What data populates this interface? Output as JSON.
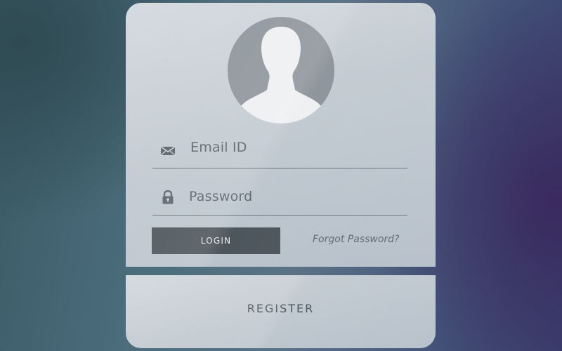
{
  "login_form": {
    "email_label": "Email ID",
    "password_label": "Password",
    "login_button": "LOGIN",
    "forgot_link": "Forgot Password?",
    "email_icon": "envelope-icon",
    "password_icon": "lock-icon",
    "avatar_icon": "user-silhouette-icon"
  },
  "register": {
    "label": "REGISTER"
  },
  "colors": {
    "card": "#c9d0d6",
    "button": "#4e565d",
    "text": "#5e666e",
    "avatar_bg": "#8f969d"
  }
}
